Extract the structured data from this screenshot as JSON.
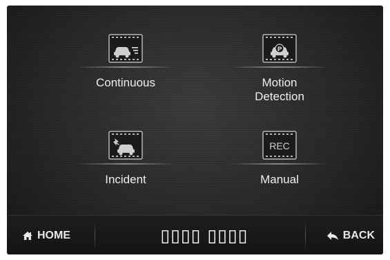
{
  "menu": {
    "items": [
      {
        "label": "Continuous",
        "icon": "car-motion-icon"
      },
      {
        "label": "Motion\nDetection",
        "icon": "car-parking-icon"
      },
      {
        "label": "Incident",
        "icon": "car-impact-icon"
      },
      {
        "label": "Manual",
        "icon": "rec-icon",
        "icon_text": "REC"
      }
    ]
  },
  "bottom_bar": {
    "home_label": "HOME",
    "title": "▯▯▯▯ ▯▯▯▯",
    "back_label": "BACK"
  },
  "colors": {
    "background": "#262626",
    "text": "#efefef",
    "bar": "#161616"
  }
}
